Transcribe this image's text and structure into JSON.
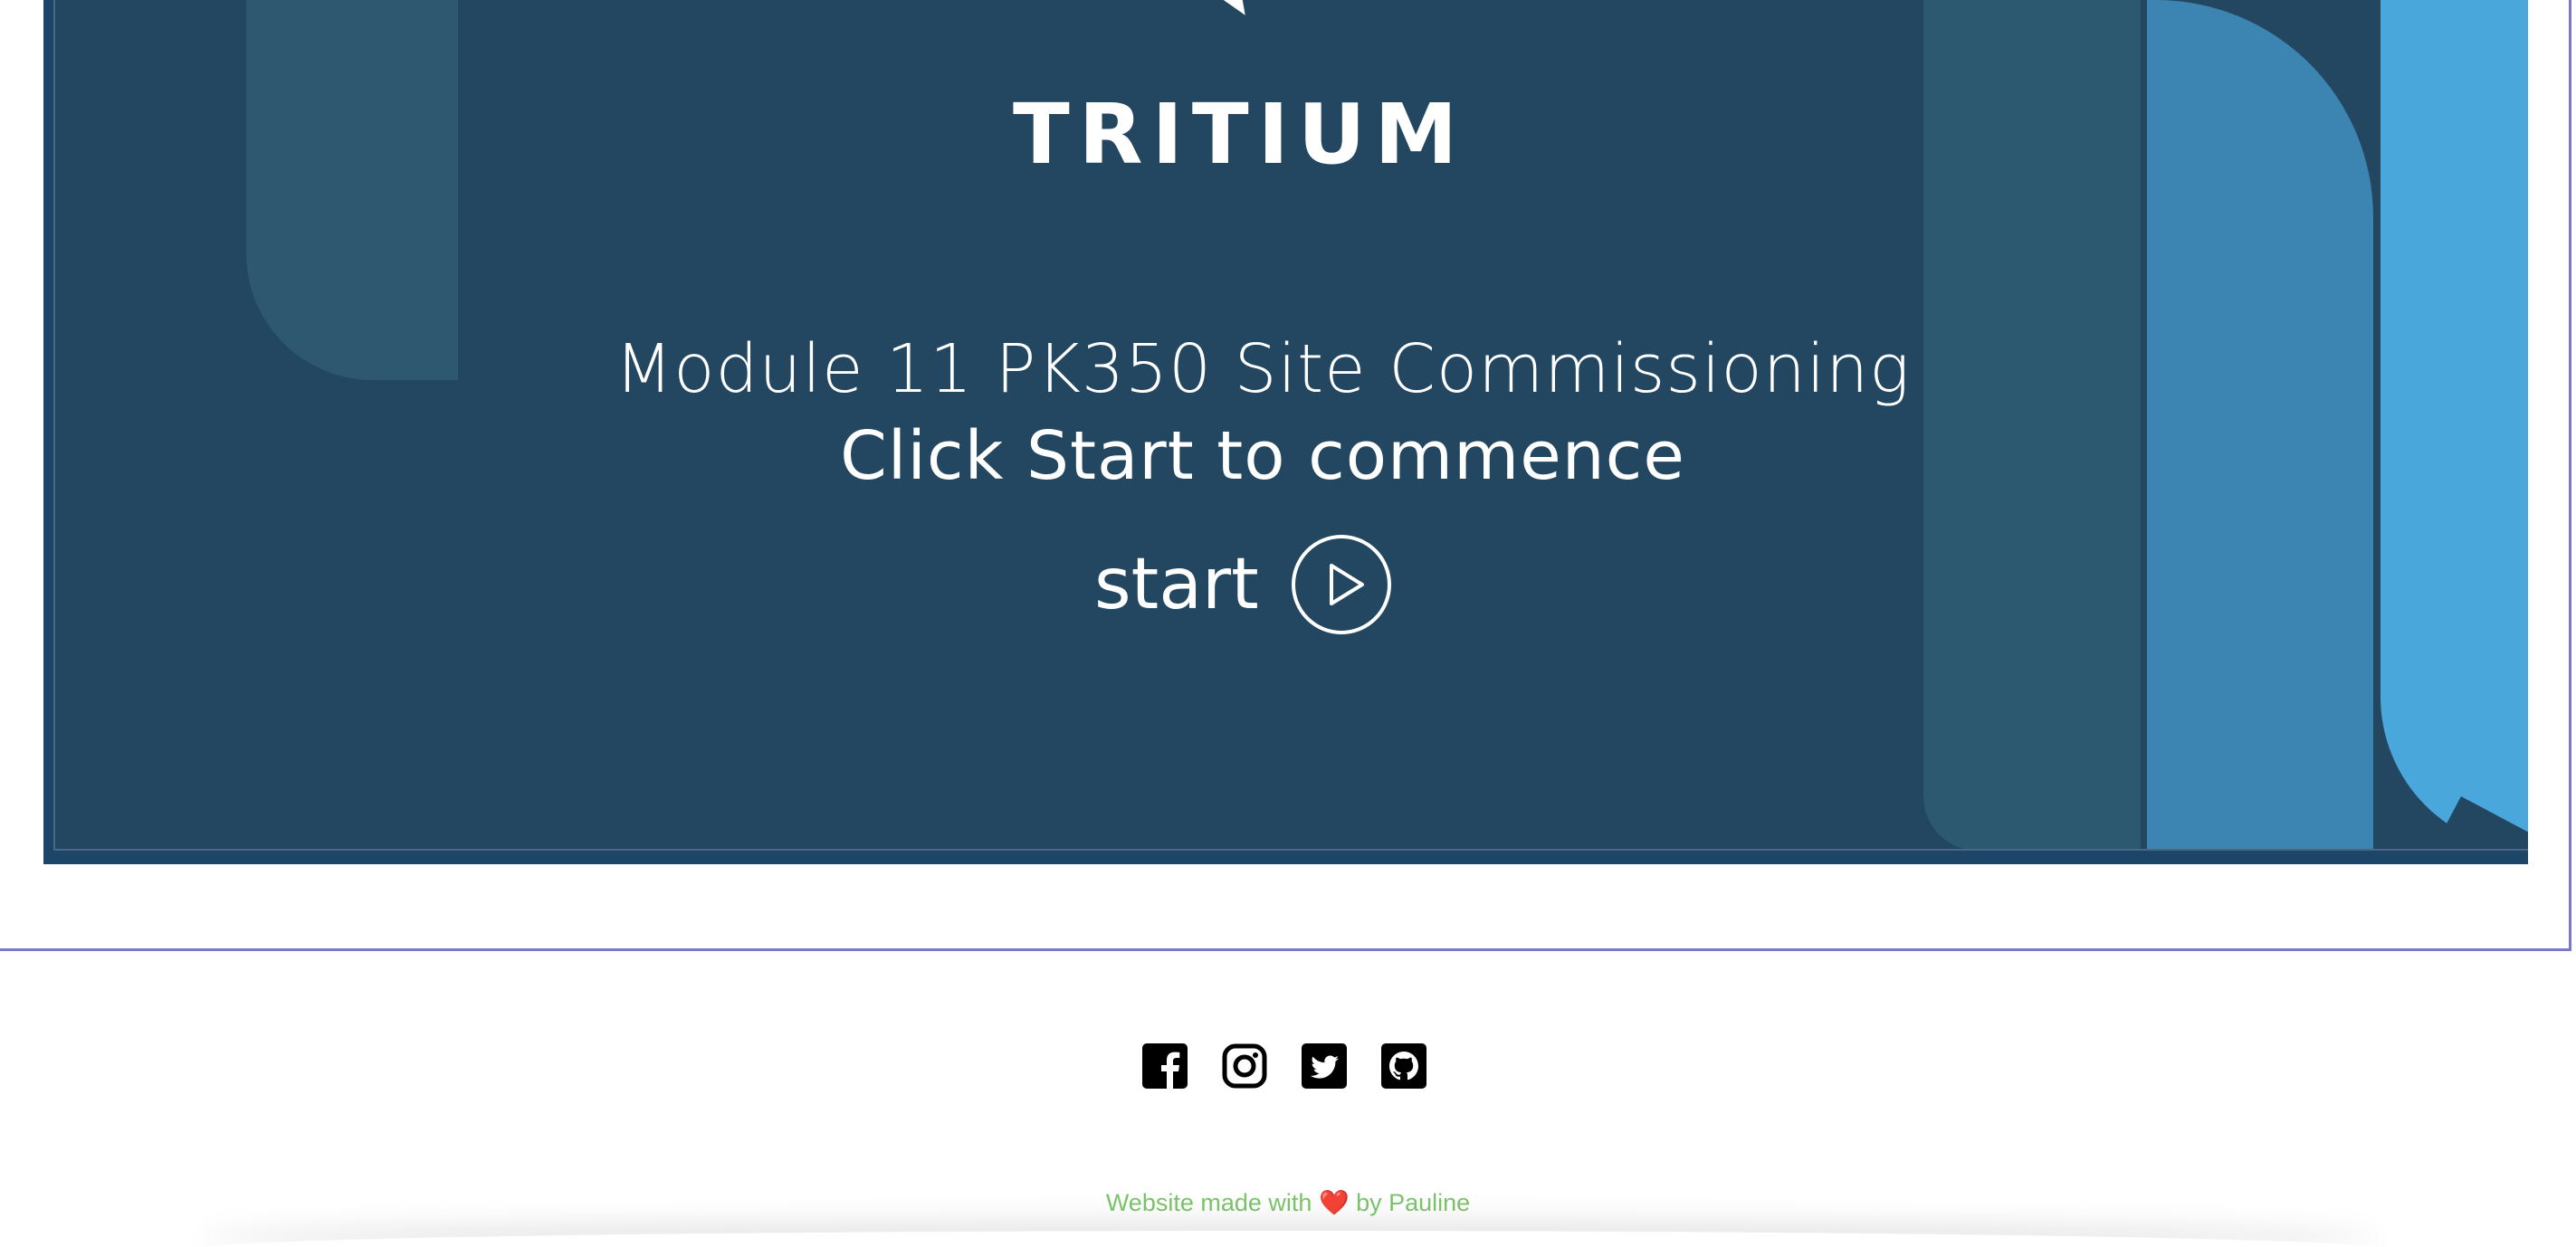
{
  "player": {
    "brand": "TRITIUM",
    "title": "Module 11 PK350 Site Commissioning",
    "subtitle": "Click Start to commence",
    "start_label": "start",
    "colors": {
      "background": "#234760",
      "frame": "#1c4567",
      "accent_dark": "#2c5870",
      "accent_mid": "#3c84b1",
      "accent_light": "#4aa7db"
    }
  },
  "footer": {
    "social": [
      {
        "name": "facebook-icon"
      },
      {
        "name": "instagram-icon"
      },
      {
        "name": "twitter-icon"
      },
      {
        "name": "github-icon"
      }
    ],
    "credit_prefix": "Website made with",
    "credit_heart": "❤️",
    "credit_suffix": "by Pauline",
    "credit_color": "#7cc46b",
    "frame_color": "#7a78c8"
  }
}
